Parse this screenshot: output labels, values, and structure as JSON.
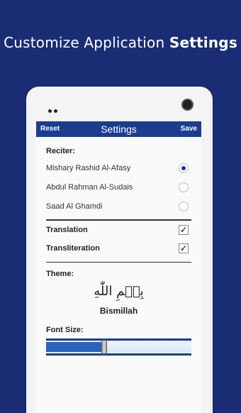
{
  "promo": {
    "title_regular": "Customize Application",
    "title_bold": "Settings"
  },
  "appbar": {
    "reset_label": "Reset",
    "title": "Settings",
    "save_label": "Save"
  },
  "reciter": {
    "label": "Reciter:",
    "options": [
      {
        "name": "Mishary Rashid Al-Afasy",
        "selected": true
      },
      {
        "name": "Abdul Rahman Al-Sudais",
        "selected": false
      },
      {
        "name": "Saad Al Ghamdi",
        "selected": false
      }
    ]
  },
  "toggles": [
    {
      "label": "Translation",
      "checked": true
    },
    {
      "label": "Transliteration",
      "checked": true
    }
  ],
  "theme": {
    "label": "Theme:",
    "arabic_text": "بِسۡمِ اللّٰهِ",
    "caption": "Bismillah"
  },
  "font_size": {
    "label": "Font Size:",
    "value_fraction": 0.4
  },
  "colors": {
    "background": "#1a2d74",
    "appbar": "#1a3d8e",
    "accent": "#2c63b8"
  },
  "icons": {
    "radio_selected": "radio-on-icon",
    "radio_empty": "radio-off-icon",
    "checkbox": "checkbox-checked-icon"
  }
}
